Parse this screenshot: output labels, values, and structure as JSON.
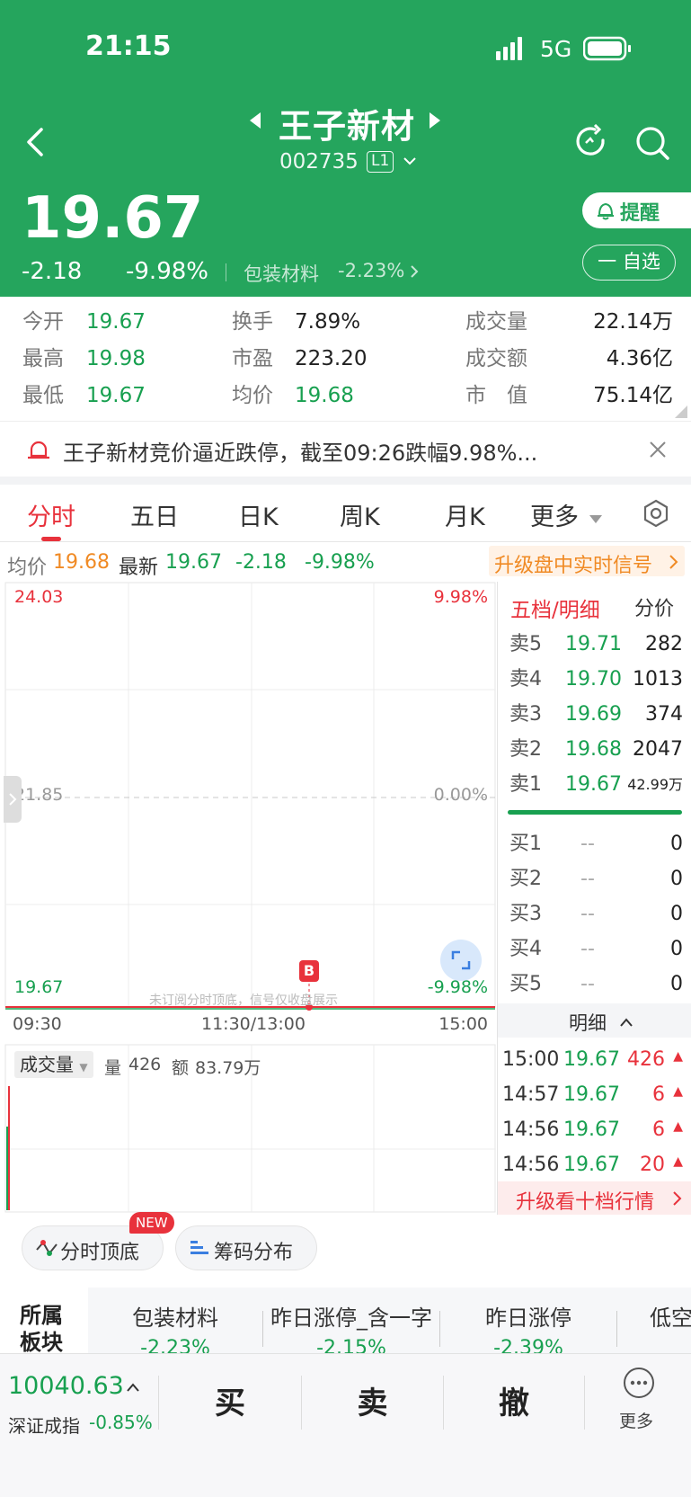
{
  "status_bar": {
    "time": "21:15",
    "network": "5G"
  },
  "stock": {
    "name": "王子新材",
    "code": "002735",
    "level": "L1"
  },
  "price": {
    "last": "19.67",
    "change": "-2.18",
    "change_pct": "-9.98%",
    "sector_name": "包装材料",
    "sector_change": "-2.23%"
  },
  "actions": {
    "remind": "提醒",
    "watchlist": "一 自选"
  },
  "quote": {
    "open_label": "今开",
    "open": "19.67",
    "high_label": "最高",
    "high": "19.98",
    "low_label": "最低",
    "low": "19.67",
    "turnover_label": "换手",
    "turnover": "7.89%",
    "pe_label": "市盈",
    "pe": "223.20",
    "avg_label": "均价",
    "avg": "19.68",
    "volume_label": "成交量",
    "volume": "22.14万",
    "amount_label": "成交额",
    "amount": "4.36亿",
    "mcap_label": "市　值",
    "mcap": "75.14亿"
  },
  "alert": {
    "text": "王子新材竞价逼近跌停，截至09:26跌幅9.98%..."
  },
  "tabs": {
    "t1": "分时",
    "t2": "五日",
    "t3": "日K",
    "t4": "周K",
    "t5": "月K",
    "more": "更多"
  },
  "info": {
    "avg_label": "均价",
    "avg": "19.68",
    "latest_label": "最新",
    "latest": "19.67",
    "chg": "-2.18",
    "pct": "-9.98%",
    "upgrade": "升级盘中实时信号"
  },
  "chart": {
    "top_price": "24.03",
    "top_pct": "9.98%",
    "mid_price": "21.85",
    "mid_pct": "0.00%",
    "bot_price": "19.67",
    "bot_pct": "-9.98%",
    "marker": "B",
    "watermark": "未订阅分时顶底，信号仅收盘展示",
    "time_start": "09:30",
    "time_mid": "11:30/13:00",
    "time_end": "15:00",
    "vol_label": "成交量",
    "vol_qty_label": "量",
    "vol_qty": "426",
    "vol_amt_label": "额",
    "vol_amt": "83.79万"
  },
  "orderbook": {
    "header": "五档/明细",
    "header_right": "分价",
    "asks": [
      {
        "label": "卖5",
        "price": "19.71",
        "vol": "282"
      },
      {
        "label": "卖4",
        "price": "19.70",
        "vol": "1013"
      },
      {
        "label": "卖3",
        "price": "19.69",
        "vol": "374"
      },
      {
        "label": "卖2",
        "price": "19.68",
        "vol": "2047"
      },
      {
        "label": "卖1",
        "price": "19.67",
        "vol": "42.99万"
      }
    ],
    "bids": [
      {
        "label": "买1",
        "price": "--",
        "vol": "0"
      },
      {
        "label": "买2",
        "price": "--",
        "vol": "0"
      },
      {
        "label": "买3",
        "price": "--",
        "vol": "0"
      },
      {
        "label": "买4",
        "price": "--",
        "vol": "0"
      },
      {
        "label": "买5",
        "price": "--",
        "vol": "0"
      }
    ],
    "detail_label": "明细",
    "ticks": [
      {
        "time": "15:00",
        "price": "19.67",
        "vol": "426"
      },
      {
        "time": "14:57",
        "price": "19.67",
        "vol": "6"
      },
      {
        "time": "14:56",
        "price": "19.67",
        "vol": "6"
      },
      {
        "time": "14:56",
        "price": "19.67",
        "vol": "20"
      }
    ],
    "upgrade": "升级看十档行情"
  },
  "features": {
    "f1": "分时顶底",
    "f1_badge": "NEW",
    "f2": "筹码分布"
  },
  "sector": {
    "title": "所属板块",
    "items": [
      {
        "name": "包装材料",
        "pct": "-2.23%"
      },
      {
        "name": "昨日涨停_含一字",
        "pct": "-2.15%"
      },
      {
        "name": "昨日涨停",
        "pct": "-2.39%"
      },
      {
        "name": "低空",
        "pct": "-"
      }
    ]
  },
  "bottom": {
    "index_value": "10040.63",
    "index_name": "深证成指",
    "index_pct": "-0.85%",
    "buy": "买",
    "sell": "卖",
    "cancel": "撤",
    "more": "更多"
  },
  "colors": {
    "brand_green": "#25a55d",
    "down_green": "#18a050",
    "up_red": "#e8323c",
    "orange": "#f08a24"
  }
}
